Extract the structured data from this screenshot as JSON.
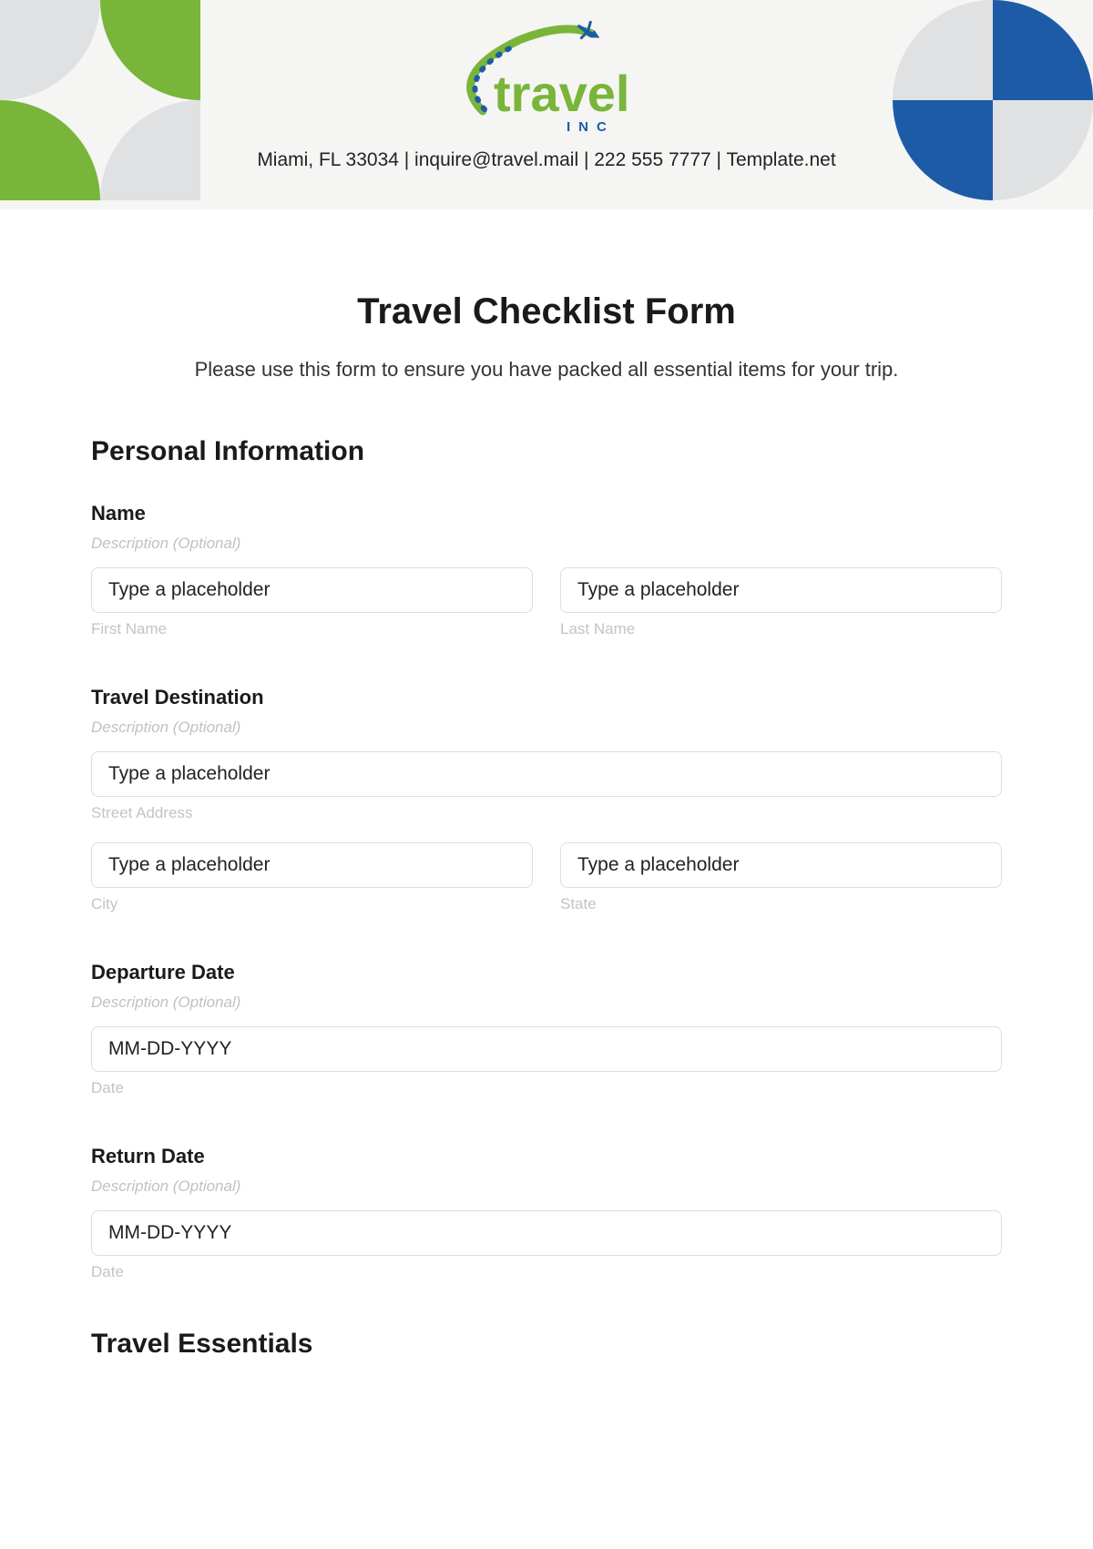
{
  "header": {
    "logo_main": "travel",
    "logo_sub": "INC",
    "contact": "Miami, FL 33034 | inquire@travel.mail | 222 555 7777 | Template.net"
  },
  "title": "Travel Checklist Form",
  "intro": "Please use this form to ensure you have packed all essential items for your trip.",
  "personal": {
    "heading": "Personal Information",
    "name": {
      "label": "Name",
      "desc": "Description (Optional)",
      "first_placeholder": "Type a placeholder",
      "first_sub": "First Name",
      "last_placeholder": "Type a placeholder",
      "last_sub": "Last Name"
    },
    "destination": {
      "label": "Travel Destination",
      "desc": "Description (Optional)",
      "street_placeholder": "Type a placeholder",
      "street_sub": "Street Address",
      "city_placeholder": "Type a placeholder",
      "city_sub": "City",
      "state_placeholder": "Type a placeholder",
      "state_sub": "State"
    },
    "departure": {
      "label": "Departure Date",
      "desc": "Description (Optional)",
      "placeholder": "MM-DD-YYYY",
      "sub": "Date"
    },
    "ret": {
      "label": "Return Date",
      "desc": "Description (Optional)",
      "placeholder": "MM-DD-YYYY",
      "sub": "Date"
    }
  },
  "essentials_heading": "Travel Essentials"
}
